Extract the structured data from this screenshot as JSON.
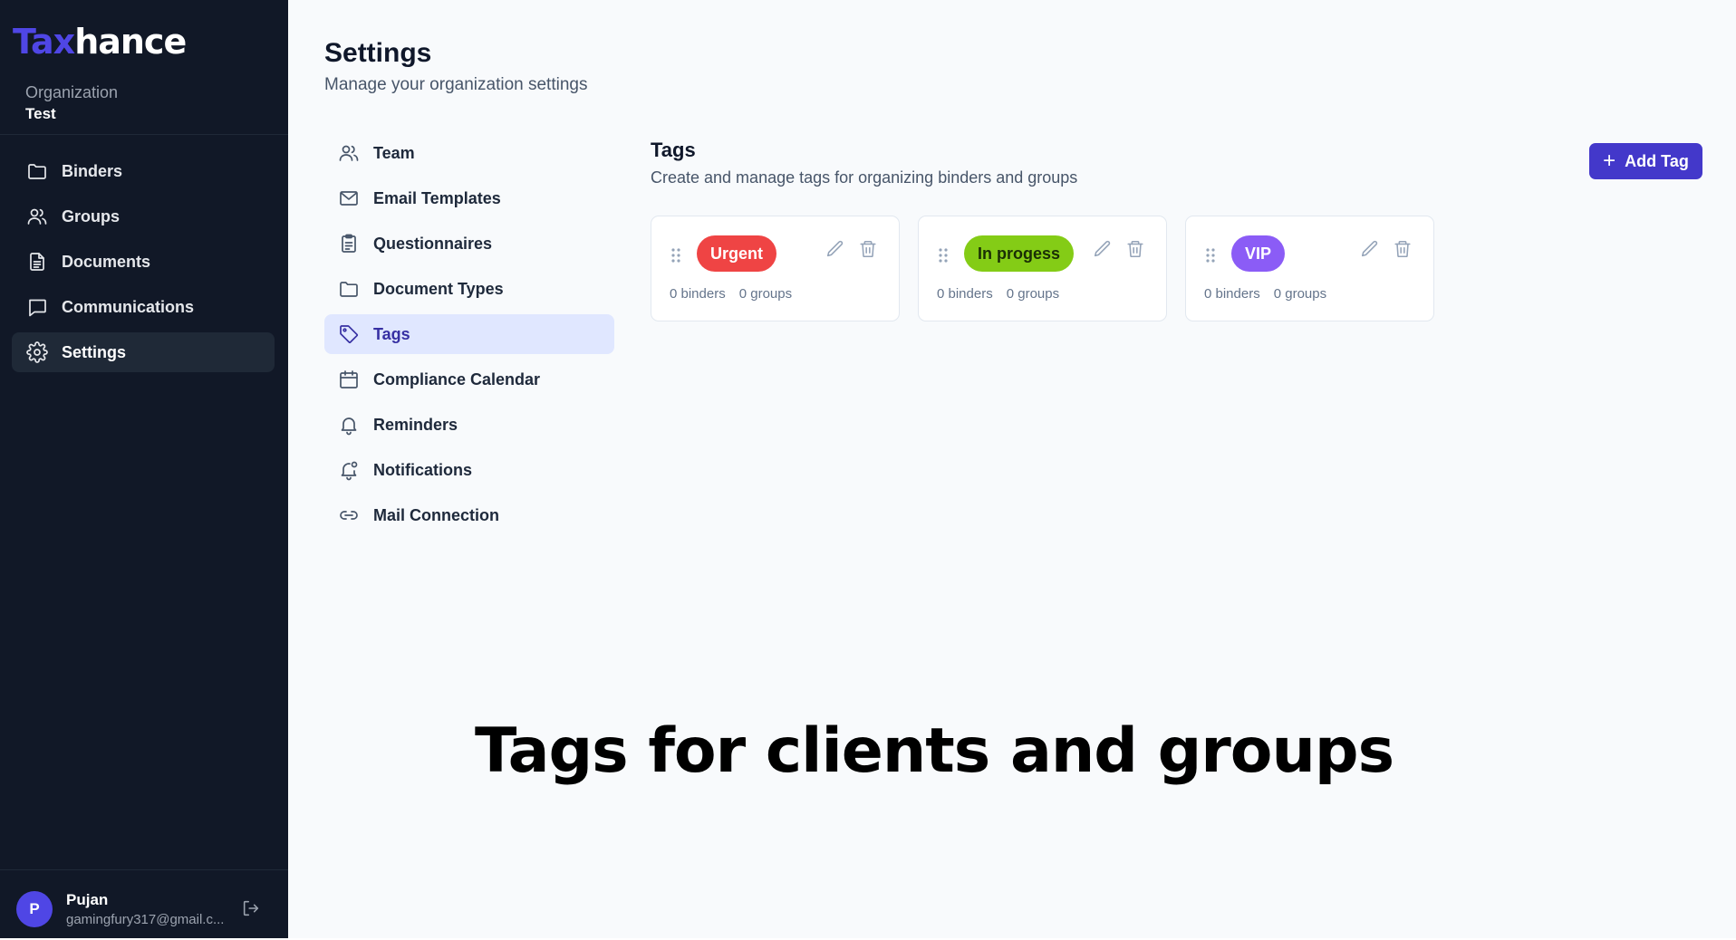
{
  "app": {
    "logo_part1": "Tax",
    "logo_part2": "hance"
  },
  "org": {
    "label": "Organization",
    "name": "Test"
  },
  "sidebar": {
    "items": [
      {
        "label": "Binders",
        "icon": "folder-icon"
      },
      {
        "label": "Groups",
        "icon": "users-icon"
      },
      {
        "label": "Documents",
        "icon": "document-icon"
      },
      {
        "label": "Communications",
        "icon": "message-icon"
      },
      {
        "label": "Settings",
        "icon": "gear-icon",
        "active": true
      }
    ]
  },
  "user": {
    "initial": "P",
    "name": "Pujan",
    "email": "gamingfury317@gmail.c..."
  },
  "page": {
    "title": "Settings",
    "subtitle": "Manage your organization settings"
  },
  "settings_nav": {
    "items": [
      {
        "label": "Team",
        "icon": "users-icon"
      },
      {
        "label": "Email Templates",
        "icon": "mail-icon"
      },
      {
        "label": "Questionnaires",
        "icon": "clipboard-icon"
      },
      {
        "label": "Document Types",
        "icon": "folder-icon"
      },
      {
        "label": "Tags",
        "icon": "tag-icon",
        "active": true
      },
      {
        "label": "Compliance Calendar",
        "icon": "calendar-icon"
      },
      {
        "label": "Reminders",
        "icon": "bell-icon"
      },
      {
        "label": "Notifications",
        "icon": "bell-dot-icon"
      },
      {
        "label": "Mail Connection",
        "icon": "link-icon"
      }
    ]
  },
  "tags_section": {
    "title": "Tags",
    "subtitle": "Create and manage tags for organizing binders and groups",
    "add_button": "Add Tag",
    "tags": [
      {
        "name": "Urgent",
        "color": "#ef4444",
        "binders": "0 binders",
        "groups": "0 groups"
      },
      {
        "name": "In progess",
        "color": "#84cc16",
        "binders": "0 binders",
        "groups": "0 groups"
      },
      {
        "name": "VIP",
        "color": "#8b5cf6",
        "binders": "0 binders",
        "groups": "0 groups"
      }
    ]
  },
  "caption": "Tags for clients and groups"
}
